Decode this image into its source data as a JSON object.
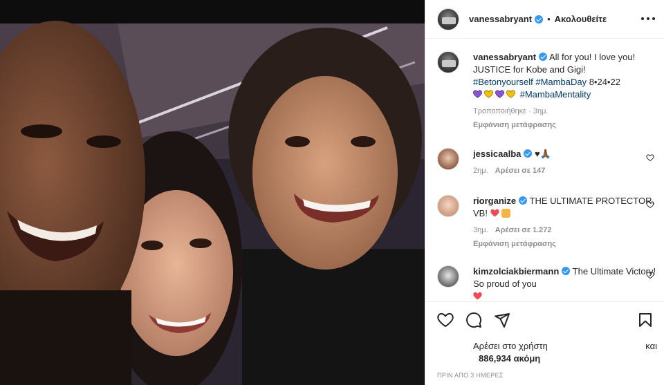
{
  "post": {
    "username": "vanessabryant",
    "follow_label": "Ακολουθείτε",
    "separator": "•"
  },
  "caption": {
    "username": "vanessabryant",
    "text": "All for you! I love you! JUSTICE for Kobe and Gigi!",
    "hashtag_1": "#Betonyourself",
    "hashtag_2": "#MambaDay",
    "date_text": "8•24•22",
    "hearts": [
      "#8a55d3",
      "#f2c200",
      "#8a55d3",
      "#f2c200"
    ],
    "hashtag_3": "#MambaMentality",
    "edited_time": "Τροποποιήθηκε · 3ημ.",
    "translate": "Εμφάνιση μετάφρασης"
  },
  "comments": [
    {
      "username": "jessicaalba",
      "text": "♥🙏🏾",
      "time": "2ημ.",
      "likes": "Αρέσει σε 147"
    },
    {
      "username": "riorganize",
      "text": "THE ULTIMATE PROTECTOR, VB!",
      "time": "3ημ.",
      "likes": "Αρέσει σε 1.272",
      "translate": "Εμφάνιση μετάφρασης"
    },
    {
      "username": "kimzolciakbiermann",
      "text": "The Ultimate Victory! So proud of you"
    }
  ],
  "likes_block": {
    "line1_start": "Αρέσει στο χρήστη",
    "line1_end": "και",
    "line2": "886,934 ακόμη"
  },
  "timestamp": "ΠΡΙΝ ΑΠΟ 3 ΗΜΕΡΕΣ",
  "icons": {
    "like": "heart-icon",
    "comment": "comment-icon",
    "share": "share-icon",
    "save": "bookmark-icon",
    "more": "more-options-icon"
  },
  "colors": {
    "verified": "#3897f0",
    "hashtag": "#00376b",
    "muted": "#8e8e8e",
    "red_heart": "#ed4956"
  }
}
